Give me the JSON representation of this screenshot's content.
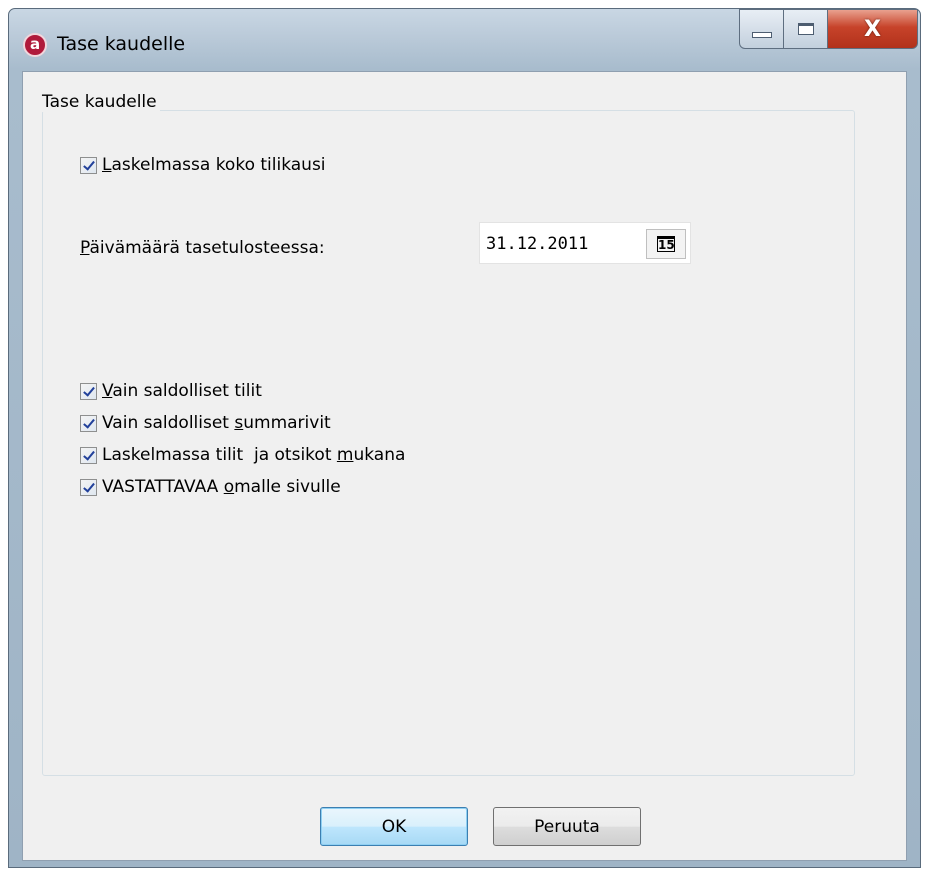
{
  "window": {
    "title": "Tase kaudelle",
    "app_icon": "a",
    "caption_buttons": {
      "minimize_icon": "minimize-icon",
      "maximize_icon": "maximize-icon",
      "close_icon": "close-icon",
      "close_glyph": "X"
    }
  },
  "group": {
    "title": "Tase kaudelle",
    "whole_year": {
      "prefix": "",
      "mnemonic": "L",
      "rest": "askelmassa koko tilikausi",
      "checked": true
    },
    "date_label": {
      "prefix": "",
      "mnemonic": "P",
      "rest": "äivämäärä tasetulosteessa:"
    },
    "date_value": "31.12.2011",
    "calendar_glyph": "15",
    "options": [
      {
        "prefix": "",
        "mnemonic": "V",
        "rest": "ain saldolliset tilit",
        "checked": true
      },
      {
        "prefix": "Vain saldolliset ",
        "mnemonic": "s",
        "rest": "ummarivit",
        "checked": true
      },
      {
        "prefix": "Laskelmassa tilit  ja otsikot ",
        "mnemonic": "m",
        "rest": "ukana",
        "checked": true
      },
      {
        "prefix": "VASTATTAVAA ",
        "mnemonic": "o",
        "rest": "malle sivulle",
        "checked": true
      }
    ]
  },
  "buttons": {
    "ok": "OK",
    "cancel": "Peruuta"
  }
}
